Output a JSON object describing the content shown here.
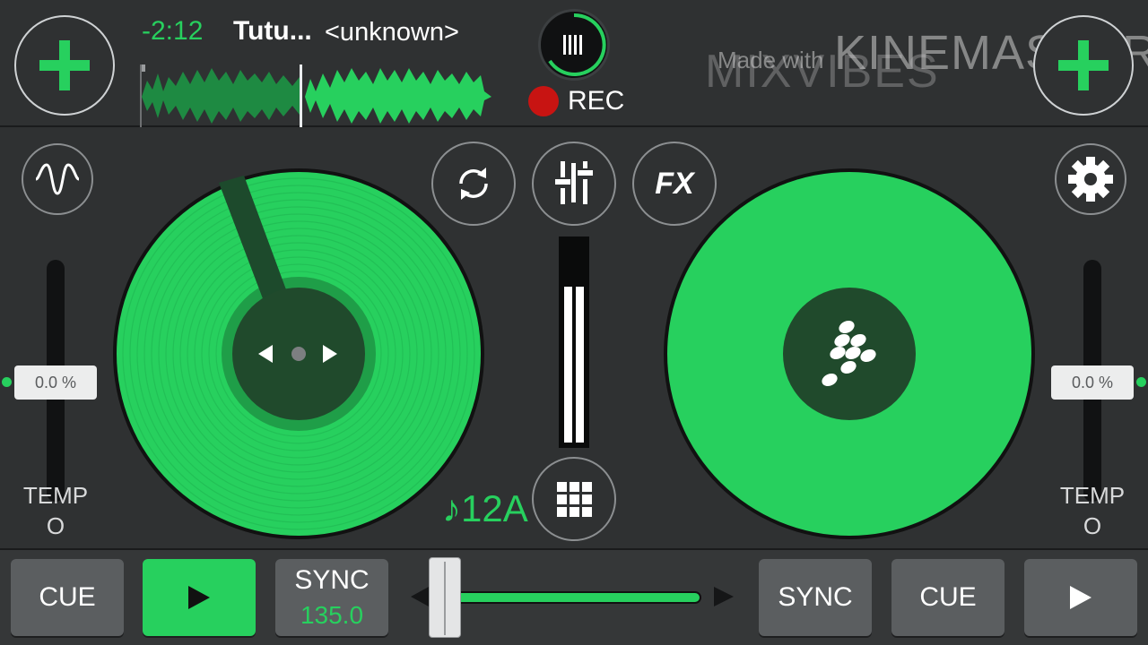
{
  "app": {
    "accent": "#27d05e",
    "background": "#2f3132"
  },
  "top": {
    "left_deck": {
      "time": "-2:12",
      "title": "Tutu...",
      "artist": "<unknown>"
    },
    "rec_label": "REC",
    "watermark": {
      "small": "Made with",
      "big": "KINEMASTER",
      "brand": "MIXVIBES"
    }
  },
  "icons": {
    "add_left": "plus-icon",
    "add_right": "plus-icon",
    "waveform": "waveform-icon",
    "settings": "gear-icon",
    "loop": "loop-icon",
    "mixer": "mixer-icon",
    "sampler": "grid-icon",
    "mixvibes": "mixvibes-disc-icon"
  },
  "controls": {
    "fx_label": "FX"
  },
  "tempo": {
    "left": {
      "value": "0.0 %",
      "label": "TEMP",
      "label2": "O"
    },
    "right": {
      "value": "0.0 %",
      "label": "TEMP",
      "label2": "O"
    }
  },
  "key": "♪12A",
  "progress": {
    "left_waveform_played_fraction": 0.46
  },
  "bottom": {
    "left": {
      "cue": "CUE",
      "sync": "SYNC",
      "bpm": "135.0"
    },
    "right": {
      "sync": "SYNC",
      "cue": "CUE"
    }
  }
}
